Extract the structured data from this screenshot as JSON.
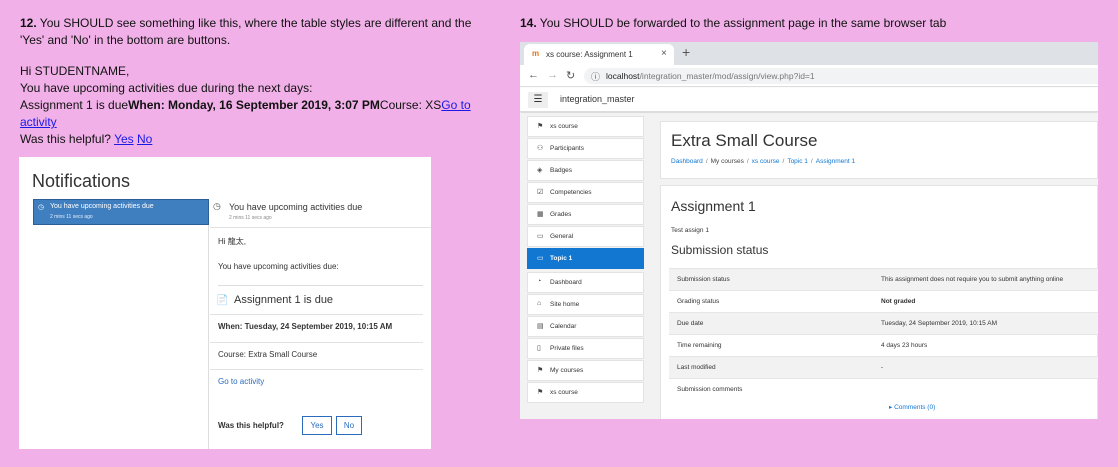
{
  "left": {
    "step_num": "12.",
    "step_text": " You SHOULD see something like this, where the table styles are different and the 'Yes' and 'No' in the bottom are buttons.",
    "greeting": "Hi STUDENTNAME,",
    "upcoming": "You have upcoming activities due during the next days:",
    "assign_prefix": "Assignment 1 is due",
    "assign_when": "When: Monday,  16 September 2019, 3:07 PM",
    "assign_course": "Course: XS",
    "go_link": "Go to activity",
    "helpful_q": "Was this helpful? ",
    "yes_link": "Yes",
    "no_link": "No"
  },
  "notifications": {
    "title": "Notifications",
    "list_item_title": "You have upcoming activities due",
    "list_item_time": "2 mins 11 secs ago",
    "detail_title": "You have upcoming activities due",
    "detail_time": "2 mins 11 secs ago",
    "greeting": "Hi 龍太,",
    "intro": "You have upcoming activities due:",
    "assignment_heading": "Assignment 1 is due",
    "when": "When: Tuesday, 24 September 2019, 10:15 AM",
    "course": "Course: Extra Small Course",
    "go_link": "Go to activity",
    "helpful": "Was this helpful?",
    "yes": "Yes",
    "no": "No"
  },
  "right": {
    "step_num": "14.",
    "step_text": " You SHOULD be forwarded to the assignment page in the same browser tab"
  },
  "browser": {
    "tab_title": "xs course: Assignment 1",
    "favicon": "m",
    "url_host": "localhost",
    "url_path": "/integration_master/mod/assign/view.php?id=1",
    "site_name": "integration_master",
    "nav": [
      {
        "label": "xs course",
        "icon": "cap-icon"
      },
      {
        "label": "Participants",
        "icon": "users-icon"
      },
      {
        "label": "Badges",
        "icon": "shield-icon"
      },
      {
        "label": "Competencies",
        "icon": "check-square-icon"
      },
      {
        "label": "Grades",
        "icon": "table-icon"
      },
      {
        "label": "General",
        "icon": "folder-icon"
      },
      {
        "label": "Topic 1",
        "icon": "folder-icon"
      },
      {
        "label": "Dashboard",
        "icon": "dashboard-icon"
      },
      {
        "label": "Site home",
        "icon": "home-icon"
      },
      {
        "label": "Calendar",
        "icon": "calendar-icon"
      },
      {
        "label": "Private files",
        "icon": "file-icon"
      },
      {
        "label": "My courses",
        "icon": "cap-icon"
      },
      {
        "label": "xs course",
        "icon": "cap-icon"
      }
    ],
    "course_title": "Extra Small Course",
    "breadcrumb": [
      "Dashboard",
      "My courses",
      "xs course",
      "Topic 1",
      "Assignment 1"
    ],
    "assignment_title": "Assignment 1",
    "description": "Test assign 1",
    "submission_heading": "Submission status",
    "status_rows": [
      {
        "label": "Submission status",
        "value": "This assignment does not require you to submit anything online"
      },
      {
        "label": "Grading status",
        "value": "Not graded"
      },
      {
        "label": "Due date",
        "value": "Tuesday, 24 September 2019, 10:15 AM"
      },
      {
        "label": "Time remaining",
        "value": "4 days 23 hours"
      },
      {
        "label": "Last modified",
        "value": "-"
      },
      {
        "label": "Submission comments",
        "value": "Comments (0)"
      }
    ],
    "accent": "#1177d1"
  }
}
